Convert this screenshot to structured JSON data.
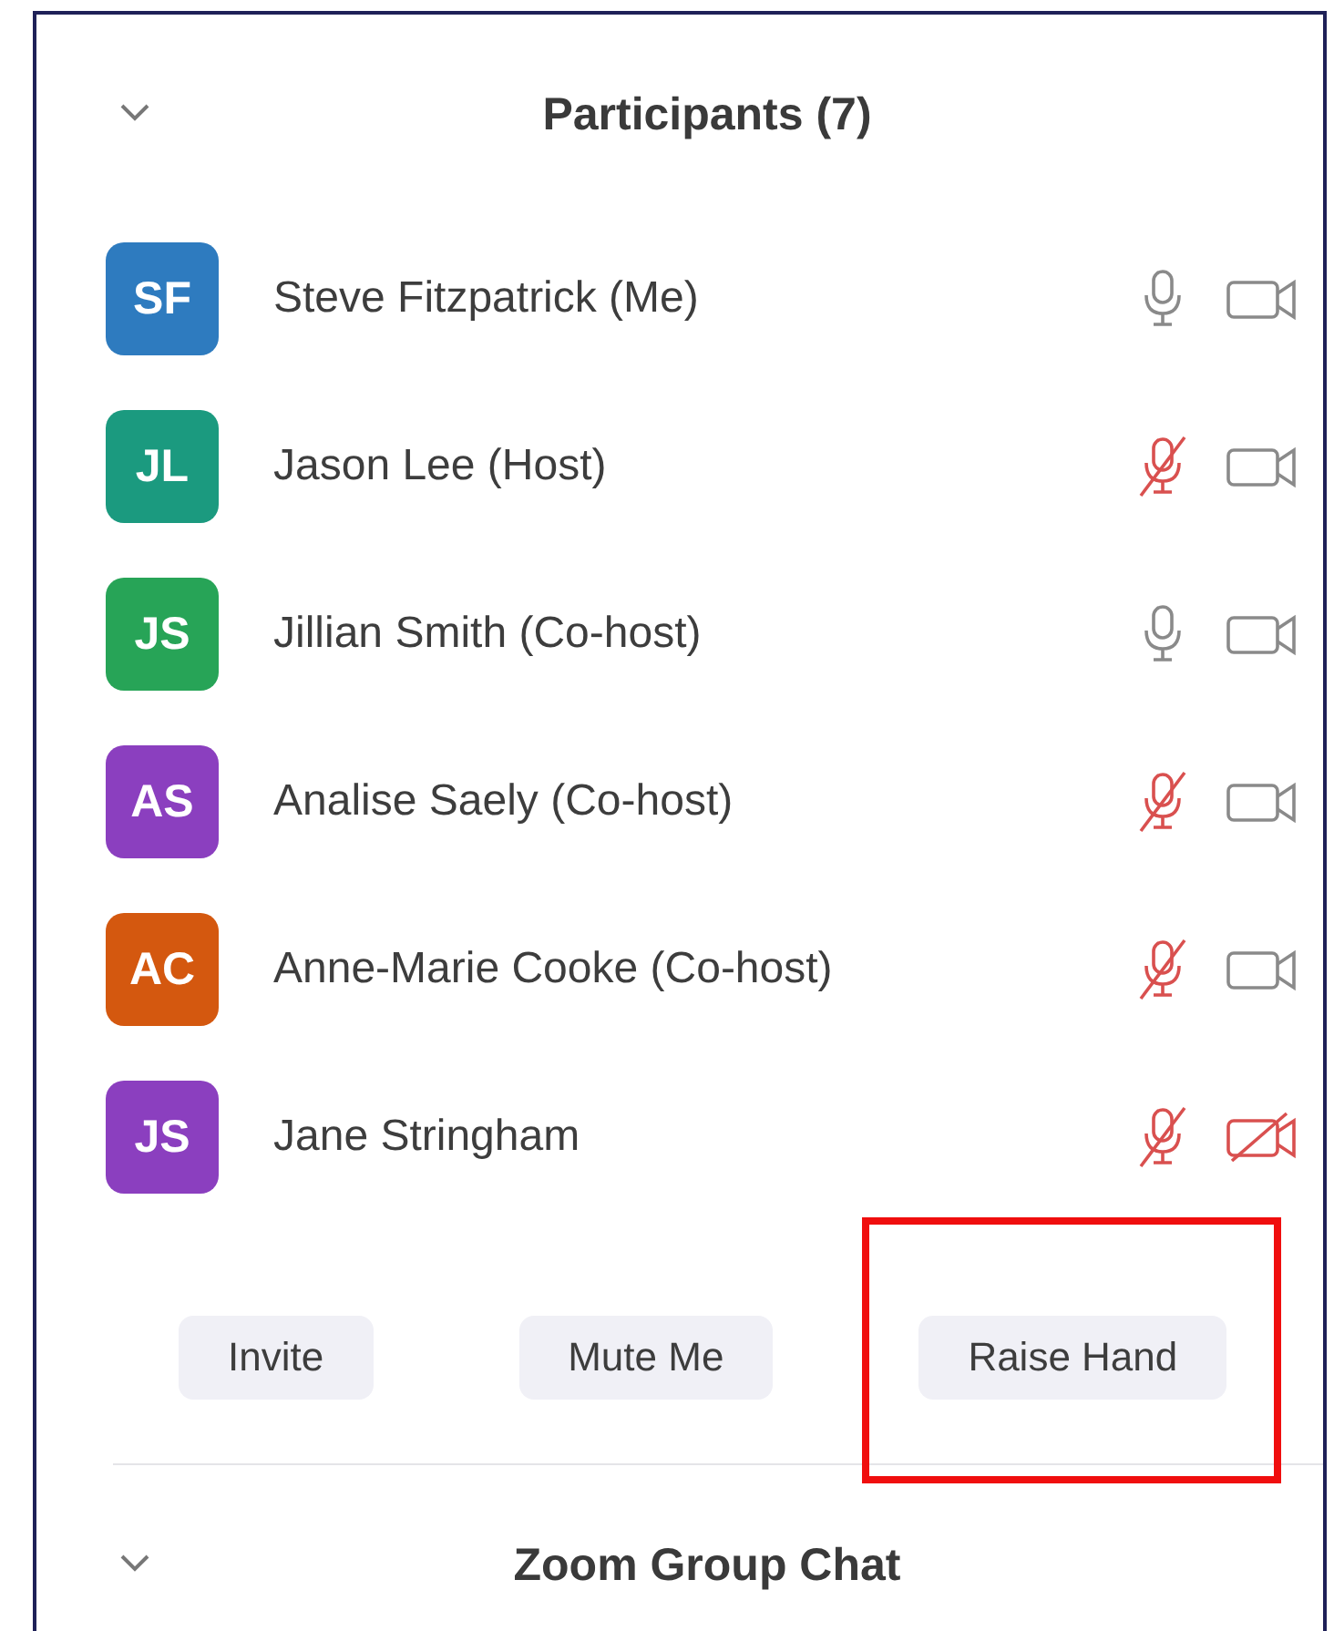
{
  "participants_panel": {
    "title": "Participants (7)",
    "expanded": true,
    "participants": [
      {
        "initials": "SF",
        "name": "Steve Fitzpatrick (Me)",
        "color": "#2e7bbf",
        "muted": false,
        "video_on": true
      },
      {
        "initials": "JL",
        "name": "Jason Lee (Host)",
        "color": "#1b9a7f",
        "muted": true,
        "video_on": true
      },
      {
        "initials": "JS",
        "name": "Jillian Smith (Co-host)",
        "color": "#27a457",
        "muted": false,
        "video_on": true
      },
      {
        "initials": "AS",
        "name": "Analise Saely (Co-host)",
        "color": "#8b3fbf",
        "muted": true,
        "video_on": true
      },
      {
        "initials": "AC",
        "name": "Anne-Marie Cooke (Co-host)",
        "color": "#d4580f",
        "muted": true,
        "video_on": true
      },
      {
        "initials": "JS",
        "name": "Jane Stringham",
        "color": "#8b3fbf",
        "muted": true,
        "video_on": false
      }
    ],
    "buttons": [
      {
        "label": "Invite",
        "highlighted": false
      },
      {
        "label": "Mute Me",
        "highlighted": false
      },
      {
        "label": "Raise Hand",
        "highlighted": true
      }
    ]
  },
  "chat_panel": {
    "title": "Zoom Group Chat",
    "expanded": true
  }
}
